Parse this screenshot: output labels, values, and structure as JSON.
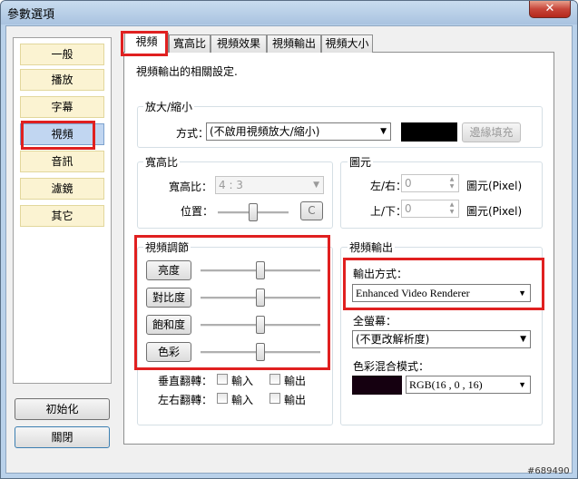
{
  "window": {
    "title": "參數選項",
    "close_glyph": "✕"
  },
  "sidebar": {
    "items": [
      {
        "label": "一般"
      },
      {
        "label": "播放"
      },
      {
        "label": "字幕"
      },
      {
        "label": "視頻"
      },
      {
        "label": "音訊"
      },
      {
        "label": "濾鏡"
      },
      {
        "label": "其它"
      }
    ],
    "selected_index": 3,
    "init_button": "初始化",
    "close_button": "關閉"
  },
  "tabs": [
    "視頻",
    "寬高比",
    "視頻效果",
    "視頻輸出",
    "視頻大小"
  ],
  "panel": {
    "description": "視頻輸出的相關設定.",
    "zoom": {
      "label": "放大/縮小",
      "method_label": "方式：",
      "method_value": "(不啟用視頻放大/縮小)",
      "border_color": "#000000",
      "border_fill_button": "邊緣填充"
    },
    "aspect": {
      "label": "寬高比",
      "ratio_label": "寬高比：",
      "ratio_value": "4 : 3",
      "position_label": "位置：",
      "position_value": 0.5,
      "reset_button": "C"
    },
    "pixel": {
      "label": "圖元",
      "lr_label": "左/右：",
      "lr_value": "0",
      "lr_unit": "圖元(Pixel)",
      "ud_label": "上/下：",
      "ud_value": "0",
      "ud_unit": "圖元(Pixel)"
    },
    "adjust": {
      "label": "視頻調節",
      "controls": [
        {
          "label": "亮度",
          "value": 0.5
        },
        {
          "label": "對比度",
          "value": 0.5
        },
        {
          "label": "飽和度",
          "value": 0.5
        },
        {
          "label": "色彩",
          "value": 0.5
        }
      ],
      "vflip_label": "垂直翻轉：",
      "hflip_label": "左右翻轉：",
      "input_label": "輸入",
      "output_label": "輸出"
    },
    "output": {
      "label": "視頻輸出",
      "method_label": "輸出方式：",
      "method_value": "Enhanced Video Renderer",
      "fullscreen_label": "全螢幕：",
      "fullscreen_value": "(不更改解析度)",
      "blend_label": "色彩混合模式：",
      "blend_color": "#150010",
      "blend_value": "RGB(16 , 0 , 16)"
    }
  },
  "watermark": "#689490",
  "colors": {
    "highlight": "#e02020",
    "selected_item": "#c1d6f1",
    "item_bg": "#fbf3d2"
  }
}
